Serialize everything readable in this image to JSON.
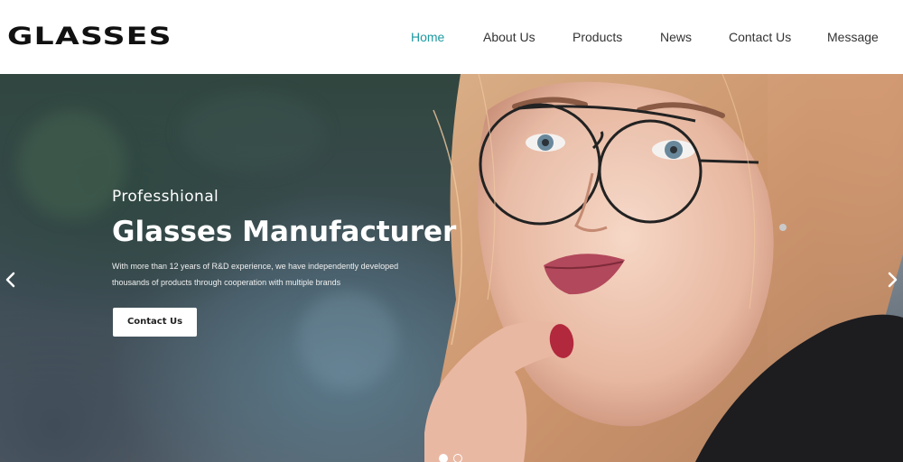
{
  "header": {
    "logo": "GLASSES",
    "nav": [
      {
        "label": "Home",
        "active": true
      },
      {
        "label": "About Us",
        "active": false
      },
      {
        "label": "Products",
        "active": false
      },
      {
        "label": "News",
        "active": false
      },
      {
        "label": "Contact Us",
        "active": false
      },
      {
        "label": "Message",
        "active": false
      }
    ],
    "active_color": "#1d9aa1"
  },
  "hero": {
    "subtitle": "Professhional",
    "title": "Glasses Manufacturer",
    "description": "With more than 12 years of R&D experience, we have independently developed thousands of products through cooperation with multiple brands",
    "cta_label": "Contact Us",
    "prev_icon": "chevron-left-icon",
    "next_icon": "chevron-right-icon",
    "slides": {
      "count": 2,
      "active_index": 0
    }
  }
}
